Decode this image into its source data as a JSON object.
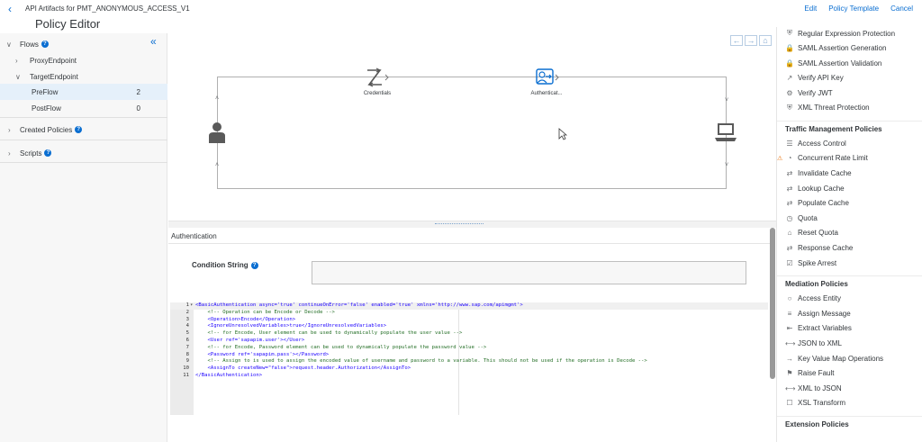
{
  "topbar": {
    "breadcrumb": "API Artifacts for PMT_ANONYMOUS_ACCESS_V1",
    "actions": {
      "edit": "Edit",
      "policy_template": "Policy Template",
      "cancel": "Cancel"
    }
  },
  "page_title": "Policy Editor",
  "left_panel": {
    "flows_label": "Flows",
    "proxy_endpoint": "ProxyEndpoint",
    "target_endpoint": "TargetEndpoint",
    "preflow": {
      "label": "PreFlow",
      "count": "2"
    },
    "postflow": {
      "label": "PostFlow",
      "count": "0"
    },
    "created_policies": "Created Policies",
    "scripts": "Scripts"
  },
  "canvas": {
    "steps": [
      {
        "label": "Credentials"
      },
      {
        "label": "Authenticat..."
      }
    ]
  },
  "properties": {
    "heading": "Authentication",
    "condition_label": "Condition String",
    "condition_value": "",
    "code_lines": [
      {
        "n": "1",
        "fold": "▾",
        "text": "<BasicAuthentication async='true' continueOnError='false' enabled='true' xmlns='http://www.sap.com/apimgmt'>"
      },
      {
        "n": "2",
        "fold": "",
        "text": "    <!-- Operation can be Encode or Decode -->"
      },
      {
        "n": "3",
        "fold": "",
        "text": "    <Operation>Encode</Operation>"
      },
      {
        "n": "4",
        "fold": "",
        "text": "    <IgnoreUnresolvedVariables>true</IgnoreUnresolvedVariables>"
      },
      {
        "n": "5",
        "fold": "",
        "text": "    <!-- for Encode, User element can be used to dynamically populate the user value -->"
      },
      {
        "n": "6",
        "fold": "",
        "text": "    <User ref='sapapim.user'></User>"
      },
      {
        "n": "7",
        "fold": "",
        "text": "    <!-- for Encode, Password element can be used to dynamically populate the password value -->"
      },
      {
        "n": "8",
        "fold": "",
        "text": "    <Password ref='sapapim.pass'></Password>"
      },
      {
        "n": "9",
        "fold": "",
        "text": "    <!-- Assign to is used to assign the encoded value of username and password to a variable. This should not be used if the operation is Decode -->"
      },
      {
        "n": "10",
        "fold": "",
        "text": "    <AssignTo createNew=\"false\">request.header.Authorization</AssignTo>"
      },
      {
        "n": "11",
        "fold": "",
        "text": "</BasicAuthentication>"
      }
    ]
  },
  "palette": {
    "partial_top": "Regular Expression Protection",
    "security_items": [
      "SAML Assertion Generation",
      "SAML Assertion Validation",
      "Verify API Key",
      "Verify JWT",
      "XML Threat Protection"
    ],
    "traffic_heading": "Traffic Management Policies",
    "traffic_items": [
      "Access Control",
      "Concurrent Rate Limit",
      "Invalidate Cache",
      "Lookup Cache",
      "Populate Cache",
      "Quota",
      "Reset Quota",
      "Response Cache",
      "Spike Arrest"
    ],
    "mediation_heading": "Mediation Policies",
    "mediation_items": [
      "Access Entity",
      "Assign Message",
      "Extract Variables",
      "JSON to XML",
      "Key Value Map Operations",
      "Raise Fault",
      "XML to JSON",
      "XSL Transform"
    ],
    "extension_heading": "Extension Policies"
  }
}
